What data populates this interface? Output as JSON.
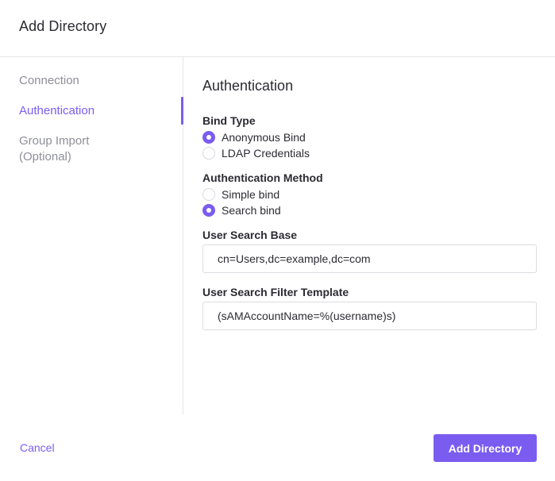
{
  "dialog": {
    "title": "Add Directory"
  },
  "sidebar": {
    "items": [
      {
        "label": "Connection",
        "active": false
      },
      {
        "label": "Authentication",
        "active": true
      },
      {
        "label": "Group Import (Optional)",
        "active": false
      }
    ]
  },
  "main": {
    "section_title": "Authentication",
    "bind_type": {
      "label": "Bind Type",
      "options": [
        {
          "label": "Anonymous Bind",
          "checked": true
        },
        {
          "label": "LDAP Credentials",
          "checked": false
        }
      ]
    },
    "auth_method": {
      "label": "Authentication Method",
      "options": [
        {
          "label": "Simple bind",
          "checked": false
        },
        {
          "label": "Search bind",
          "checked": true
        }
      ]
    },
    "user_search_base": {
      "label": "User Search Base",
      "value": "cn=Users,dc=example,dc=com"
    },
    "user_search_filter": {
      "label": "User Search Filter Template",
      "value": "(sAMAccountName=%(username)s)"
    }
  },
  "footer": {
    "cancel_label": "Cancel",
    "submit_label": "Add Directory"
  },
  "colors": {
    "accent": "#7b5cf0",
    "border": "#e6e6ea",
    "muted_text": "#8e8e99"
  }
}
